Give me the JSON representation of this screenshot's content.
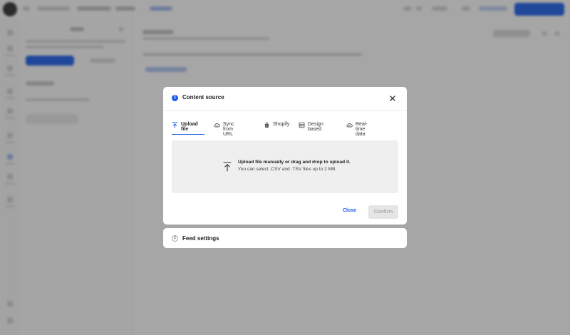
{
  "modal": {
    "step1": {
      "number": "1",
      "title": "Content source"
    },
    "tabs": [
      {
        "label": "Upload file",
        "icon": "upload-icon",
        "active": true
      },
      {
        "label": "Sync from URL",
        "icon": "cloud-sync-icon",
        "active": false
      },
      {
        "label": "Shopify",
        "icon": "shopify-bag-icon",
        "active": false
      },
      {
        "label": "Design based",
        "icon": "table-icon",
        "active": false
      },
      {
        "label": "Real-time data",
        "icon": "cloud-live-icon",
        "active": false
      }
    ],
    "dropzone": {
      "line1": "Upload file manually or drag and drop to upload it.",
      "line2": "You can select .CSV and .TSV files up to 2 MB."
    },
    "actions": {
      "close_label": "Close",
      "confirm_label": "Confirm"
    },
    "step2": {
      "number": "2",
      "title": "Feed settings"
    }
  },
  "colors": {
    "accent": "#1a5ce6",
    "overlay": "#282828",
    "dropzone_bg": "#efefef",
    "disabled_bg": "#e5e5e5"
  }
}
